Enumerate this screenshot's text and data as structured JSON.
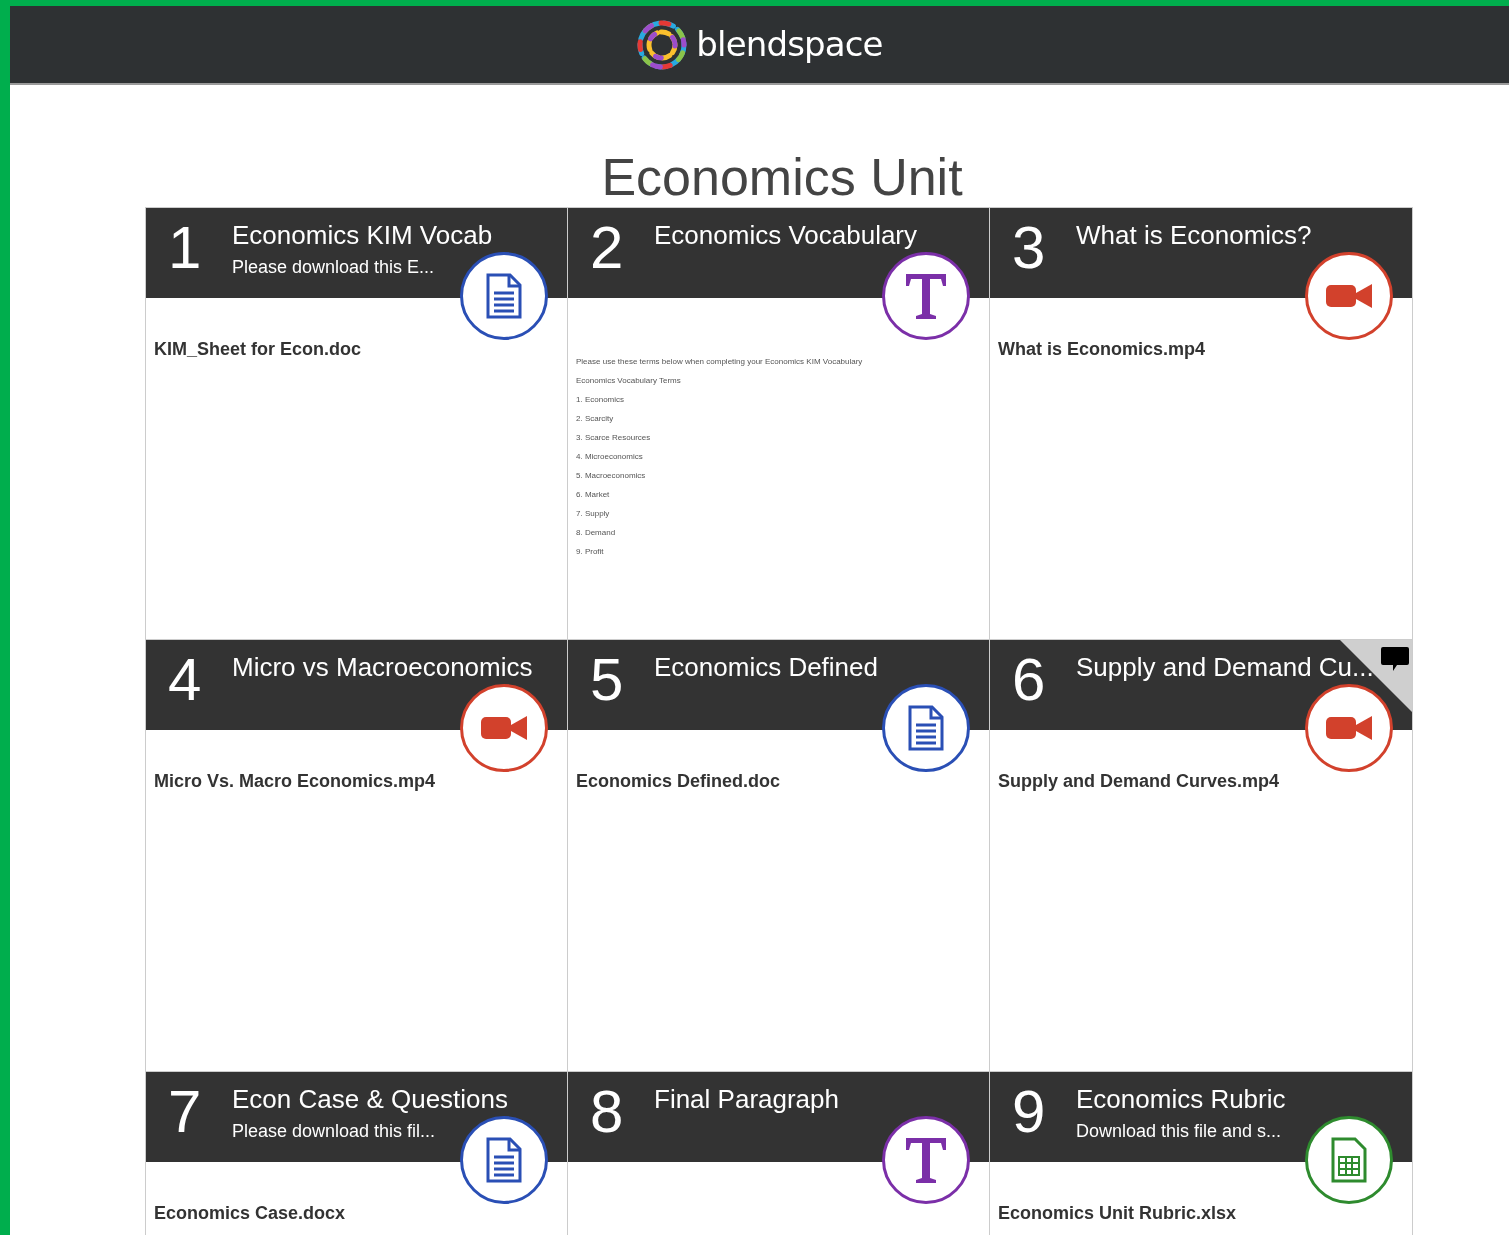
{
  "header": {
    "logo_text": "blendspace"
  },
  "title": "Economics Unit",
  "cards": [
    {
      "number": "1",
      "title": "Economics KIM Vocab",
      "subtitle": "Please download this E...",
      "kind": "doc",
      "file": "KIM_Sheet for Econ.doc",
      "comment": false
    },
    {
      "number": "2",
      "title": "Economics Vocabulary",
      "kind": "text",
      "preview": [
        "Please use these terms below when completing your Economics KIM Vocabulary",
        "Economics Vocabulary Terms",
        "1. Economics",
        "2. Scarcity",
        "3. Scarce Resources",
        "4. Microeconomics",
        "5. Macroeconomics",
        "6. Market",
        "7. Supply",
        "8. Demand",
        "9. Profit"
      ],
      "comment": false
    },
    {
      "number": "3",
      "title": "What is Economics?",
      "kind": "video",
      "file": "What is Economics.mp4",
      "comment": false
    },
    {
      "number": "4",
      "title": "Micro vs Macroeconomics",
      "kind": "video",
      "file": "Micro Vs. Macro Economics.mp4",
      "comment": false
    },
    {
      "number": "5",
      "title": "Economics Defined",
      "kind": "doc",
      "file": "Economics Defined.doc",
      "comment": false
    },
    {
      "number": "6",
      "title": "Supply and Demand Cu...",
      "kind": "video",
      "file": "Supply and Demand Curves.mp4",
      "comment": true
    },
    {
      "number": "7",
      "title": "Econ Case & Questions",
      "subtitle": "Please download this fil...",
      "kind": "doc",
      "file": "Economics Case.docx",
      "comment": false
    },
    {
      "number": "8",
      "title": "Final Paragraph",
      "kind": "text",
      "comment": false
    },
    {
      "number": "9",
      "title": "Economics Rubric",
      "subtitle": "Download this file and s...",
      "kind": "sheet",
      "file": "Economics Unit Rubric.xlsx",
      "comment": false
    }
  ]
}
